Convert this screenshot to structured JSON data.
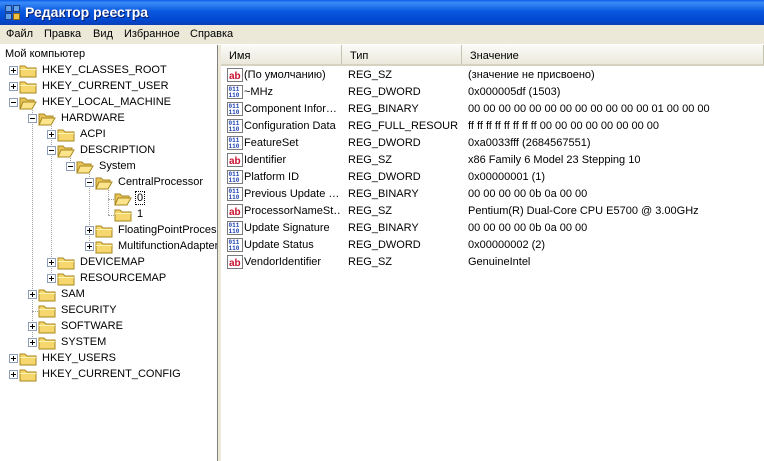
{
  "window": {
    "title": "Редактор реестра"
  },
  "menu": [
    "Файл",
    "Правка",
    "Вид",
    "Избранное",
    "Справка"
  ],
  "tree": {
    "root": "Мой компьютер",
    "nodes": [
      {
        "label": "HKEY_CLASSES_ROOT",
        "expander": "plus"
      },
      {
        "label": "HKEY_CURRENT_USER",
        "expander": "plus"
      },
      {
        "label": "HKEY_LOCAL_MACHINE",
        "expander": "minus"
      },
      {
        "label": "HARDWARE",
        "expander": "minus"
      },
      {
        "label": "ACPI",
        "expander": "plus"
      },
      {
        "label": "DESCRIPTION",
        "expander": "minus"
      },
      {
        "label": "System",
        "expander": "minus"
      },
      {
        "label": "CentralProcessor",
        "expander": "minus"
      },
      {
        "label": "0",
        "expander": "none",
        "selected": true
      },
      {
        "label": "1",
        "expander": "none"
      },
      {
        "label": "FloatingPointProcessor",
        "expander": "plus"
      },
      {
        "label": "MultifunctionAdapter",
        "expander": "plus"
      },
      {
        "label": "DEVICEMAP",
        "expander": "plus"
      },
      {
        "label": "RESOURCEMAP",
        "expander": "plus"
      },
      {
        "label": "SAM",
        "expander": "plus"
      },
      {
        "label": "SECURITY",
        "expander": "none"
      },
      {
        "label": "SOFTWARE",
        "expander": "plus"
      },
      {
        "label": "SYSTEM",
        "expander": "plus"
      },
      {
        "label": "HKEY_USERS",
        "expander": "plus"
      },
      {
        "label": "HKEY_CURRENT_CONFIG",
        "expander": "plus"
      }
    ]
  },
  "list": {
    "columns": [
      "Имя",
      "Тип",
      "Значение"
    ],
    "rows": [
      {
        "icon": "string-value-icon",
        "name": "(По умолчанию)",
        "type": "REG_SZ",
        "value": "(значение не присвоено)"
      },
      {
        "icon": "binary-value-icon",
        "name": "~MHz",
        "type": "REG_DWORD",
        "value": "0x000005df (1503)"
      },
      {
        "icon": "binary-value-icon",
        "name": "Component Infor…",
        "type": "REG_BINARY",
        "value": "00 00 00 00 00 00 00 00 00 00 00 00 01 00 00 00"
      },
      {
        "icon": "binary-value-icon",
        "name": "Configuration Data",
        "type": "REG_FULL_RESOUR…",
        "value": "ff ff ff ff ff ff ff ff 00 00 00 00 00 00 00 00"
      },
      {
        "icon": "binary-value-icon",
        "name": "FeatureSet",
        "type": "REG_DWORD",
        "value": "0xa0033fff (2684567551)"
      },
      {
        "icon": "string-value-icon",
        "name": "Identifier",
        "type": "REG_SZ",
        "value": "x86 Family 6 Model 23 Stepping 10"
      },
      {
        "icon": "binary-value-icon",
        "name": "Platform ID",
        "type": "REG_DWORD",
        "value": "0x00000001 (1)"
      },
      {
        "icon": "binary-value-icon",
        "name": "Previous Update …",
        "type": "REG_BINARY",
        "value": "00 00 00 00 0b 0a 00 00"
      },
      {
        "icon": "string-value-icon",
        "name": "ProcessorNameSt…",
        "type": "REG_SZ",
        "value": "Pentium(R) Dual-Core  CPU      E5700  @ 3.00GHz"
      },
      {
        "icon": "binary-value-icon",
        "name": "Update Signature",
        "type": "REG_BINARY",
        "value": "00 00 00 00 0b 0a 00 00"
      },
      {
        "icon": "binary-value-icon",
        "name": "Update Status",
        "type": "REG_DWORD",
        "value": "0x00000002 (2)"
      },
      {
        "icon": "string-value-icon",
        "name": "VendorIdentifier",
        "type": "REG_SZ",
        "value": "GenuineIntel"
      }
    ]
  },
  "colors": {
    "title_blue": "#0a58e0",
    "folder_yellow": "#f5d76e",
    "string_icon_red": "#c8102e",
    "binary_icon_blue": "#1a3fb0"
  }
}
